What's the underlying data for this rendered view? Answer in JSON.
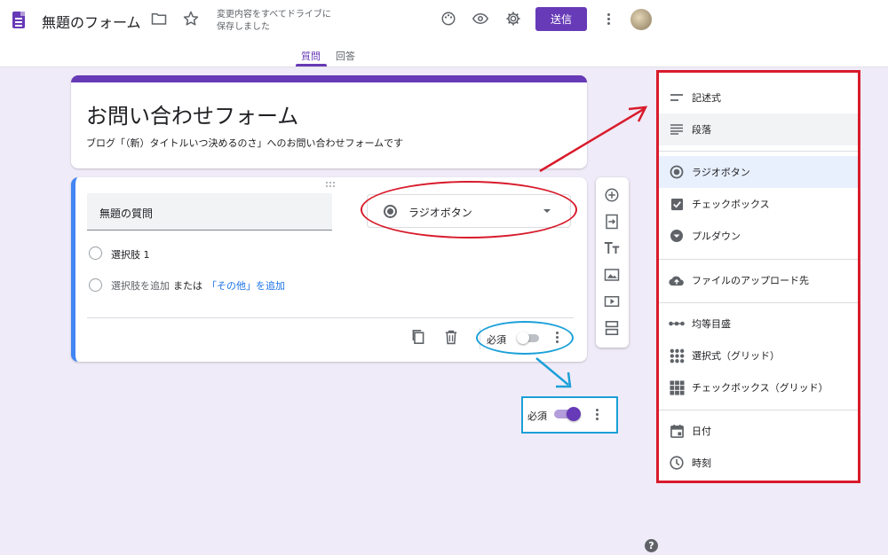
{
  "header": {
    "doc_title": "無題のフォーム",
    "save_status": "変更内容をすべてドライブに保存しました",
    "send_label": "送信",
    "icons": [
      "folder-icon",
      "star-icon",
      "palette-icon",
      "preview-icon",
      "settings-icon",
      "more-vert-icon"
    ]
  },
  "tabs": [
    {
      "label": "質問",
      "active": true
    },
    {
      "label": "回答",
      "active": false
    }
  ],
  "form": {
    "title": "お問い合わせフォーム",
    "description": "ブログ「（新）タイトルいつ決めるのさ」へのお問い合わせフォームです"
  },
  "question": {
    "title": "無題の質問",
    "type_label": "ラジオボタン",
    "option_1": "選択肢 1",
    "add_option": "選択肢を追加",
    "or_text": "または",
    "add_other": "「その他」を追加",
    "required_label": "必須",
    "required": false
  },
  "type_menu": {
    "items": [
      {
        "label": "記述式",
        "icon": "short-text-icon"
      },
      {
        "label": "段落",
        "icon": "paragraph-icon"
      },
      {
        "label": "ラジオボタン",
        "icon": "radio-button-icon"
      },
      {
        "label": "チェックボックス",
        "icon": "checkbox-icon"
      },
      {
        "label": "プルダウン",
        "icon": "dropdown-icon"
      },
      {
        "label": "ファイルのアップロード先",
        "icon": "cloud-upload-icon"
      },
      {
        "label": "均等目盛",
        "icon": "linear-scale-icon"
      },
      {
        "label": "選択式（グリッド）",
        "icon": "radio-grid-icon"
      },
      {
        "label": "チェックボックス（グリッド）",
        "icon": "checkbox-grid-icon"
      },
      {
        "label": "日付",
        "icon": "calendar-icon"
      },
      {
        "label": "時刻",
        "icon": "clock-icon"
      }
    ],
    "hovered": "段落",
    "selected": "ラジオボタン"
  },
  "required_zoom": {
    "label": "必須",
    "required": true
  },
  "colors": {
    "accent": "#673ab7",
    "background": "#f0ebf8",
    "focus_border": "#4285f4",
    "callout_red": "#d81b2b",
    "callout_blue": "#1ba0d8",
    "link": "#1a73e8"
  }
}
